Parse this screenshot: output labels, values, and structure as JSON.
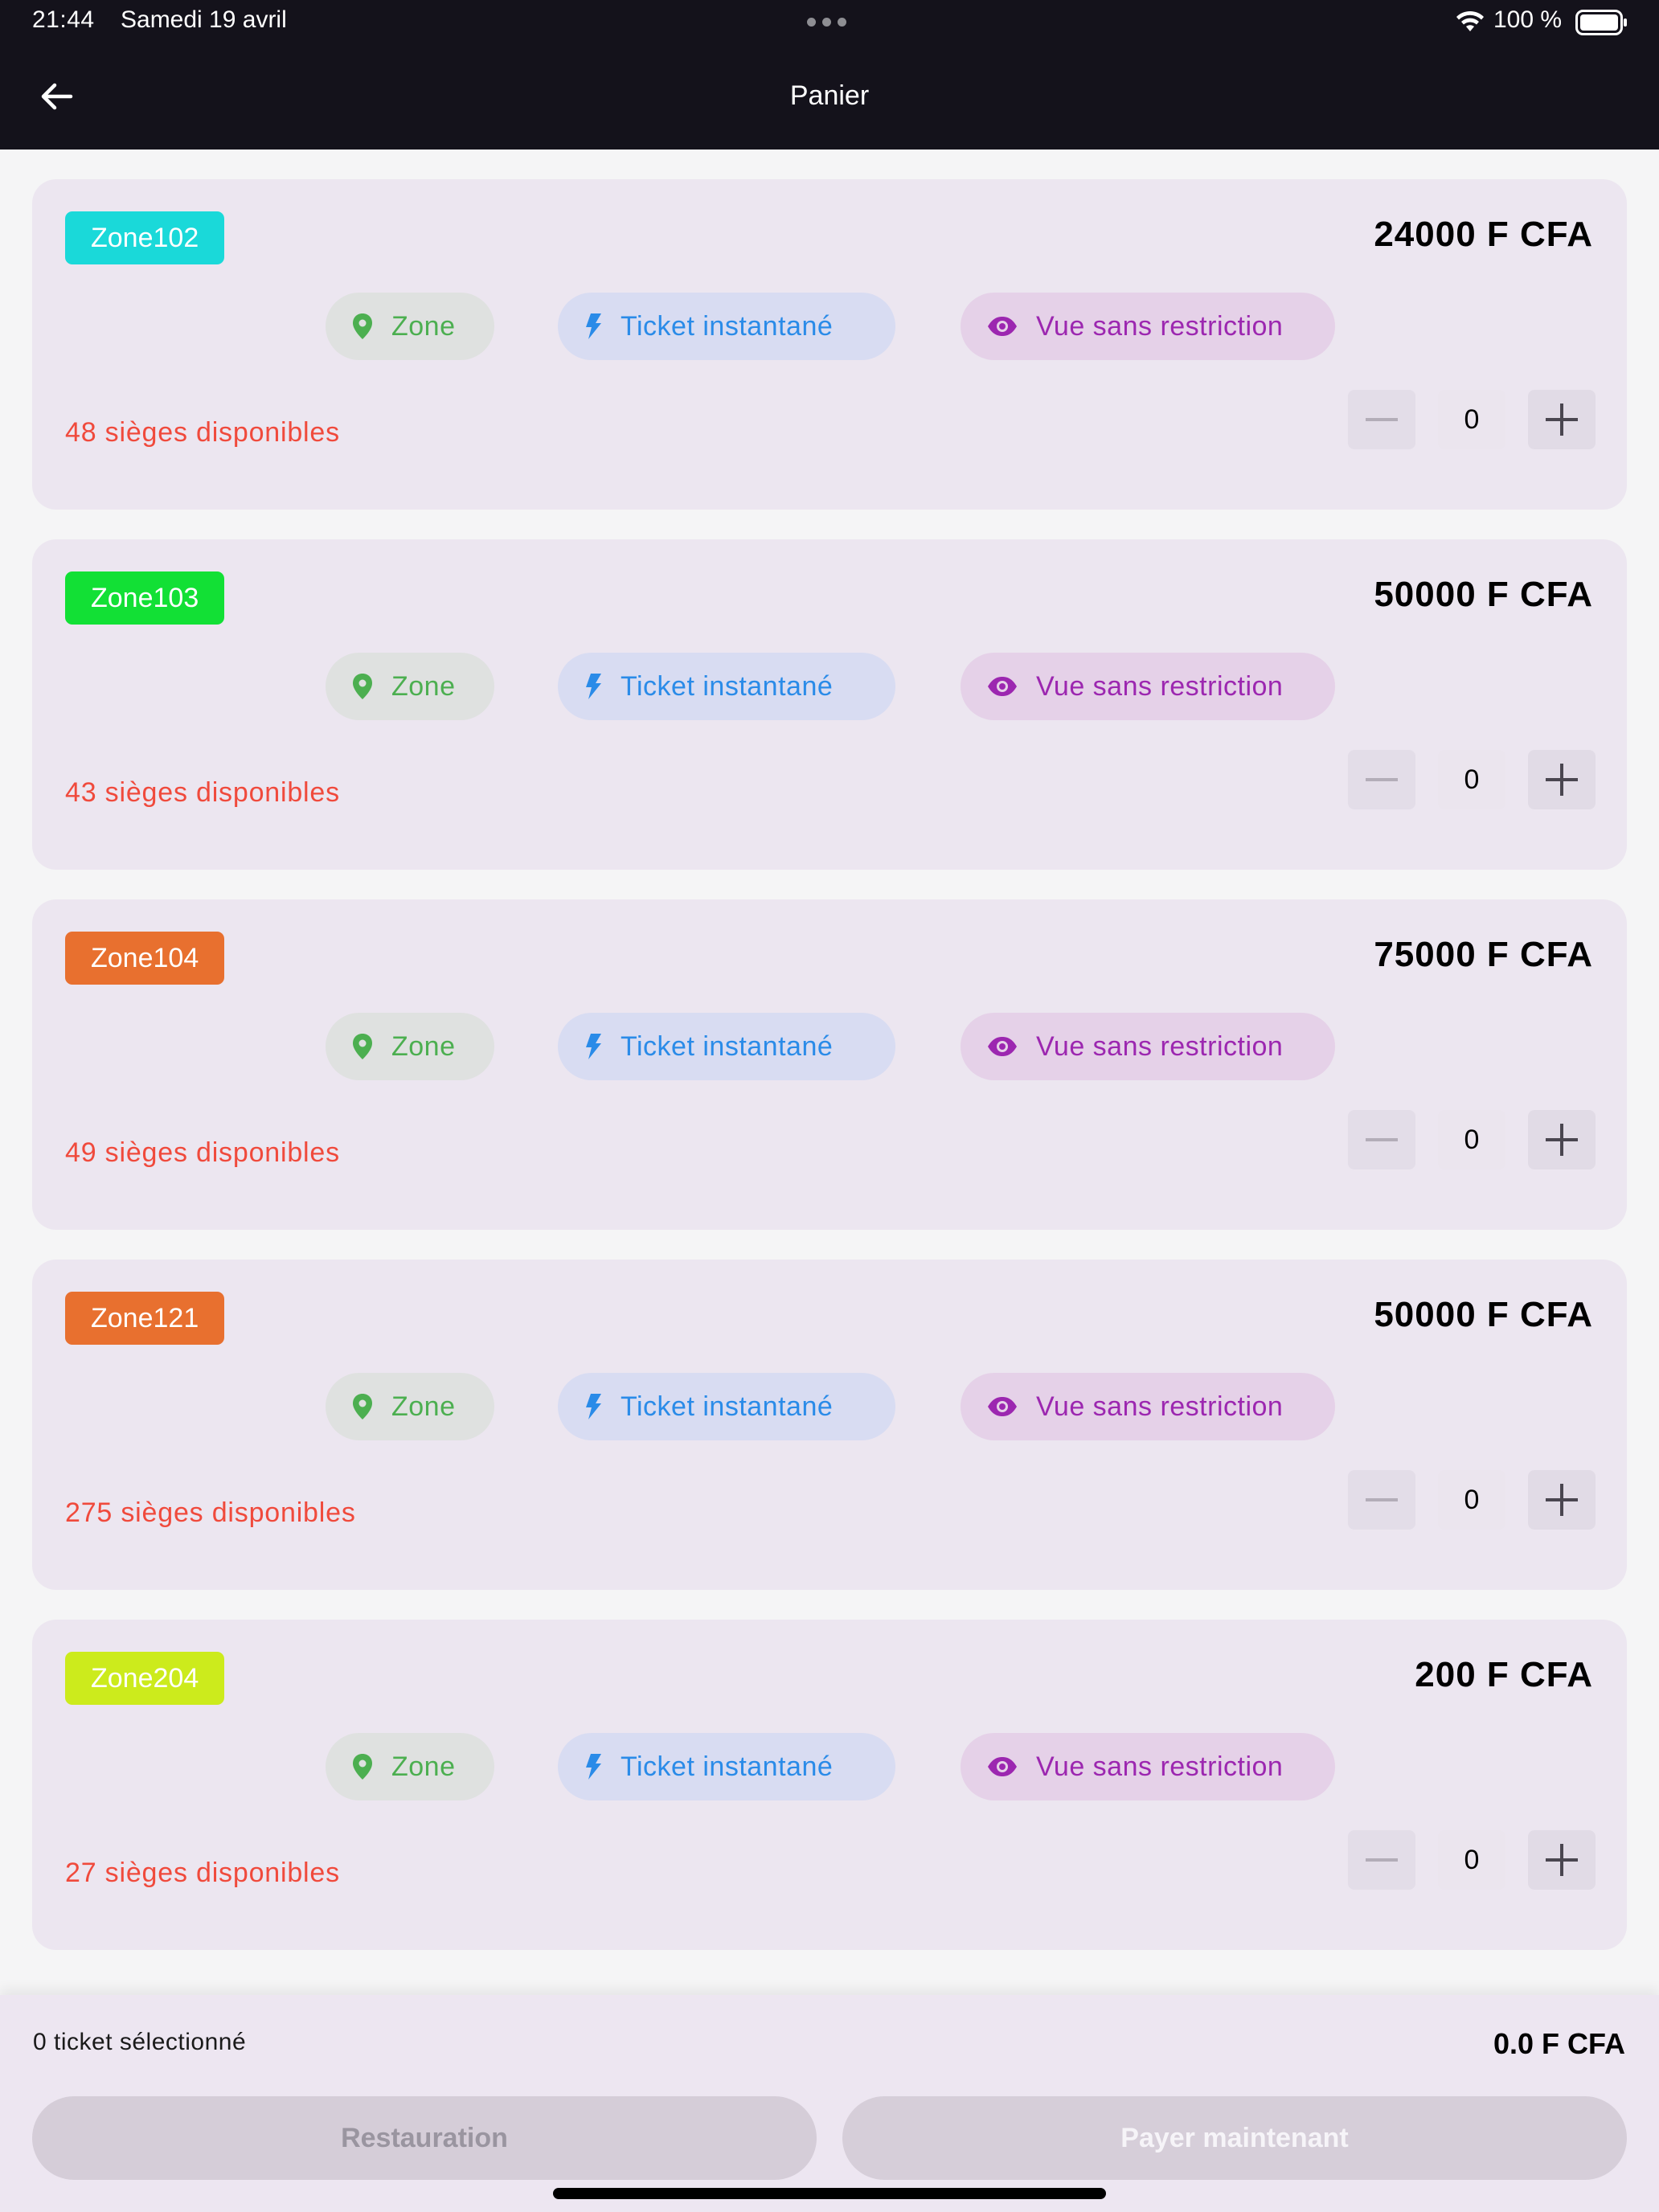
{
  "status_bar": {
    "time": "21:44",
    "date": "Samedi 19 avril",
    "battery": "100 %"
  },
  "app_bar": {
    "title": "Panier"
  },
  "chips": {
    "zone": "Zone",
    "ticket": "Ticket instantané",
    "view": "Vue sans restriction"
  },
  "colors": {
    "chip_zone": "#4caf50",
    "chip_ticket": "#2a8be8",
    "chip_view": "#9c27b0",
    "seats_text": "#f04a3c"
  },
  "icons": {
    "back": "arrow-left-icon",
    "zone_chip": "location-pin-icon",
    "ticket_chip": "lightning-bolt-icon",
    "view_chip": "eye-icon",
    "minus": "minus-icon",
    "plus": "plus-icon"
  },
  "zones": [
    {
      "name": "Zone102",
      "color": "#1ad9d9",
      "price": "24000 F CFA",
      "seats": "48 sièges disponibles",
      "quantity": "0"
    },
    {
      "name": "Zone103",
      "color": "#12e035",
      "price": "50000 F CFA",
      "seats": "43 sièges disponibles",
      "quantity": "0"
    },
    {
      "name": "Zone104",
      "color": "#e8702f",
      "price": "75000 F CFA",
      "seats": "49 sièges disponibles",
      "quantity": "0"
    },
    {
      "name": "Zone121",
      "color": "#e8702f",
      "price": "50000 F CFA",
      "seats": "275 sièges disponibles",
      "quantity": "0"
    },
    {
      "name": "Zone204",
      "color": "#cceb1c",
      "price": "200 F CFA",
      "seats": "27 sièges disponibles",
      "quantity": "0"
    }
  ],
  "footer": {
    "selected": "0 ticket sélectionné",
    "total": "0.0 F CFA",
    "restauration_label": "Restauration",
    "pay_label": "Payer maintenant"
  }
}
